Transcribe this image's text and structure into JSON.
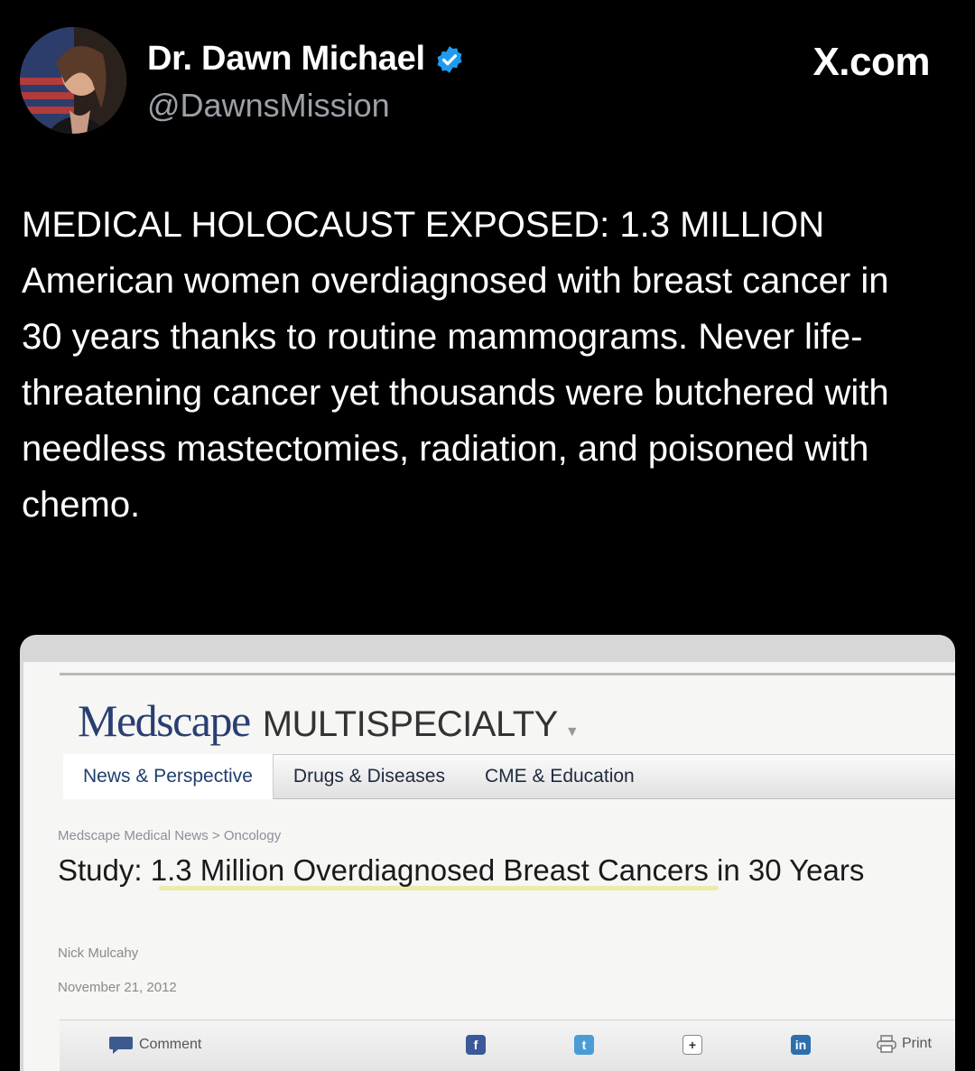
{
  "header": {
    "display_name": "Dr. Dawn Michael",
    "handle": "@DawnsMission",
    "site": "X.com"
  },
  "tweet": {
    "text": "MEDICAL HOLOCAUST EXPOSED: 1.3 MILLION American women overdiagnosed with breast cancer in 30 years thanks to routine mammograms. Never life-threatening cancer yet thousands were butchered with needless mastectomies, radiation, and poisoned with chemo."
  },
  "embed": {
    "logo": "Medscape",
    "specialty": "MULTISPECIALTY",
    "nav": [
      "News & Perspective",
      "Drugs & Diseases",
      "CME & Education"
    ],
    "breadcrumb": "Medscape Medical News > Oncology",
    "headline": "Study: 1.3 Million Overdiagnosed Breast Cancers in 30 Years",
    "author": "Nick Mulcahy",
    "date": "November 21, 2012",
    "share": {
      "comment": "Comment",
      "print": "Print"
    }
  },
  "colors": {
    "verified": "#1d9bf0",
    "medscape_blue": "#2a3e73",
    "facebook": "#3b5998",
    "twitter": "#4a9bd6",
    "linkedin": "#2d6fae"
  },
  "icons": [
    "verified-badge-icon",
    "facebook-icon",
    "twitter-icon",
    "google-plus-icon",
    "linkedin-icon",
    "print-icon",
    "comment-icon"
  ]
}
